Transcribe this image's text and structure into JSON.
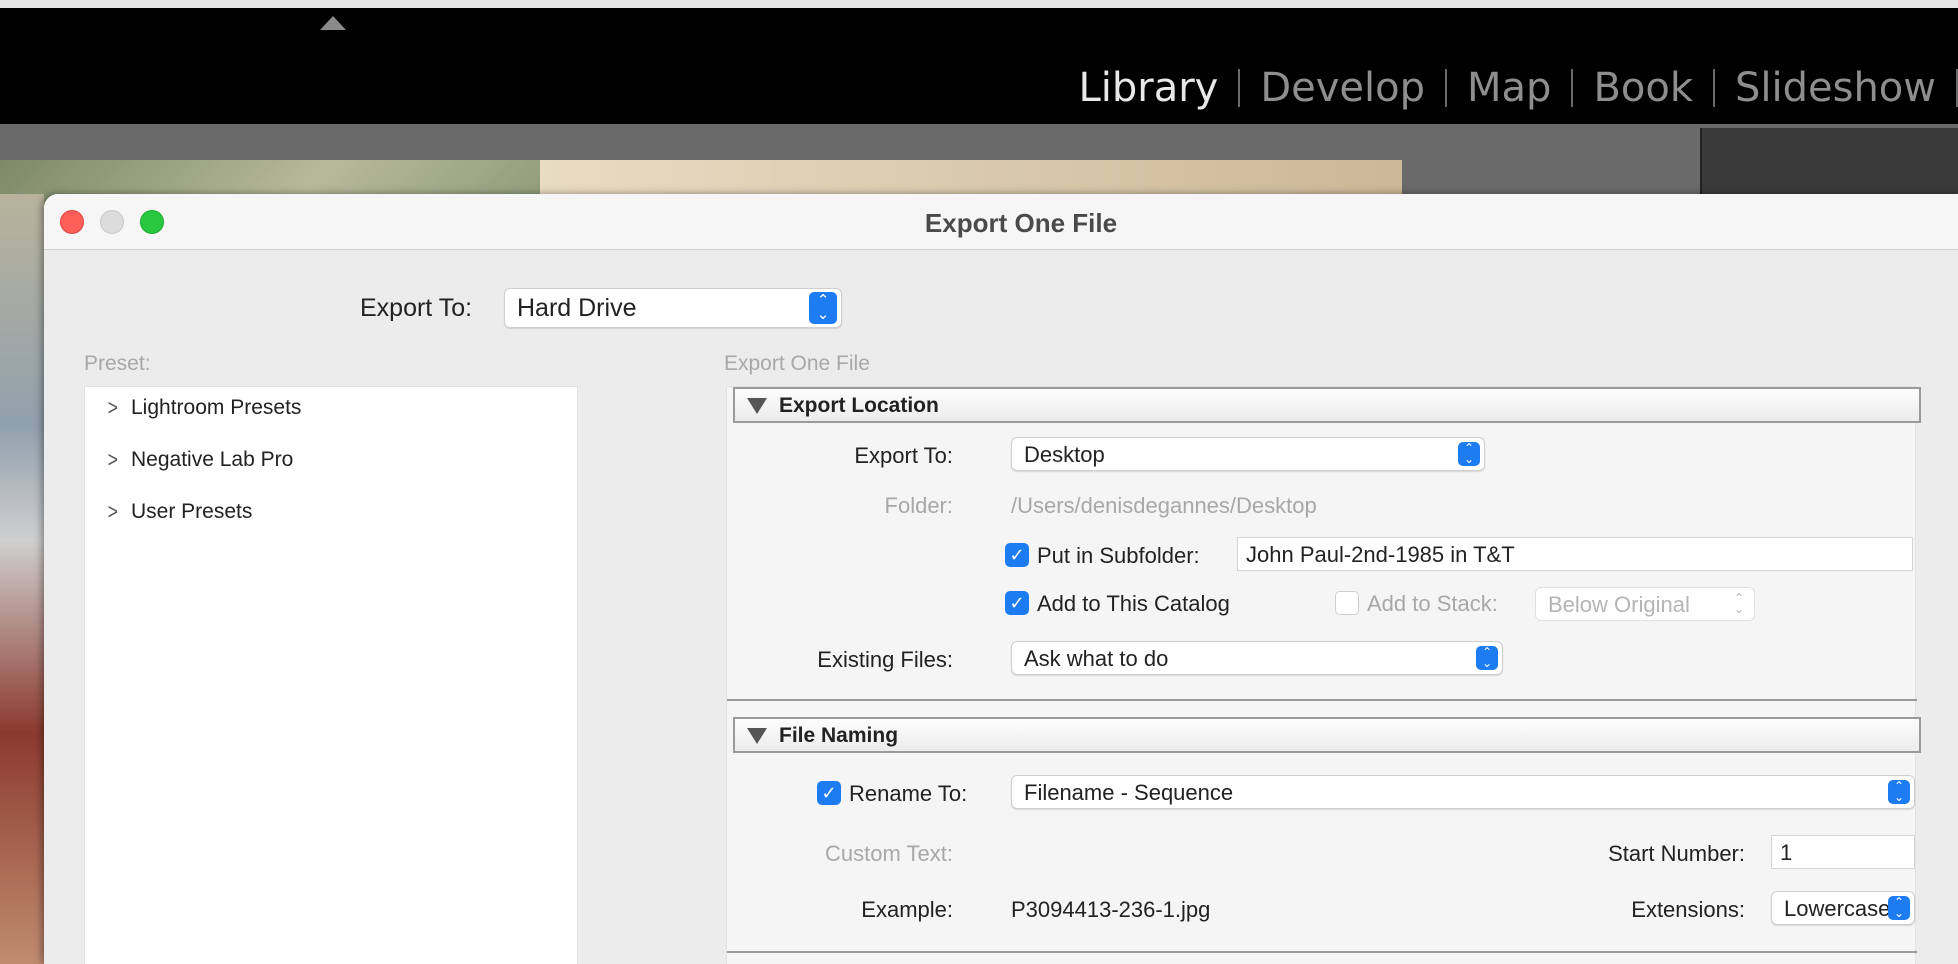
{
  "topbar": {
    "modules": [
      {
        "label": "Library",
        "active": true
      },
      {
        "label": "Develop",
        "active": false
      },
      {
        "label": "Map",
        "active": false
      },
      {
        "label": "Book",
        "active": false
      },
      {
        "label": "Slideshow",
        "active": false
      }
    ]
  },
  "dialog": {
    "title": "Export One File",
    "export_to_label": "Export To:",
    "export_to_value": "Hard Drive",
    "preset_label": "Preset:",
    "presets": [
      {
        "label": "Lightroom Presets"
      },
      {
        "label": "Negative Lab Pro"
      },
      {
        "label": "User Presets"
      }
    ],
    "panel_header": "Export One File",
    "export_location": {
      "title": "Export Location",
      "export_to_label": "Export To:",
      "export_to_value": "Desktop",
      "folder_label": "Folder:",
      "folder_value": "/Users/denisdegannes/Desktop",
      "subfolder_checked": true,
      "subfolder_label": "Put in Subfolder:",
      "subfolder_value": "John Paul-2nd-1985 in T&T",
      "catalog_checked": true,
      "catalog_label": "Add to This Catalog",
      "stack_checked": false,
      "stack_label": "Add to Stack:",
      "stack_value": "Below Original",
      "existing_label": "Existing Files:",
      "existing_value": "Ask what to do"
    },
    "file_naming": {
      "title": "File Naming",
      "rename_checked": true,
      "rename_label": "Rename To:",
      "rename_value": "Filename - Sequence",
      "custom_text_label": "Custom Text:",
      "start_number_label": "Start Number:",
      "start_number_value": "1",
      "example_label": "Example:",
      "example_value": "P3094413-236-1.jpg",
      "extensions_label": "Extensions:",
      "extensions_value": "Lowercase"
    }
  },
  "colors": {
    "accent": "#1e7cf2",
    "close": "#fe5f57",
    "zoom": "#28c840"
  }
}
